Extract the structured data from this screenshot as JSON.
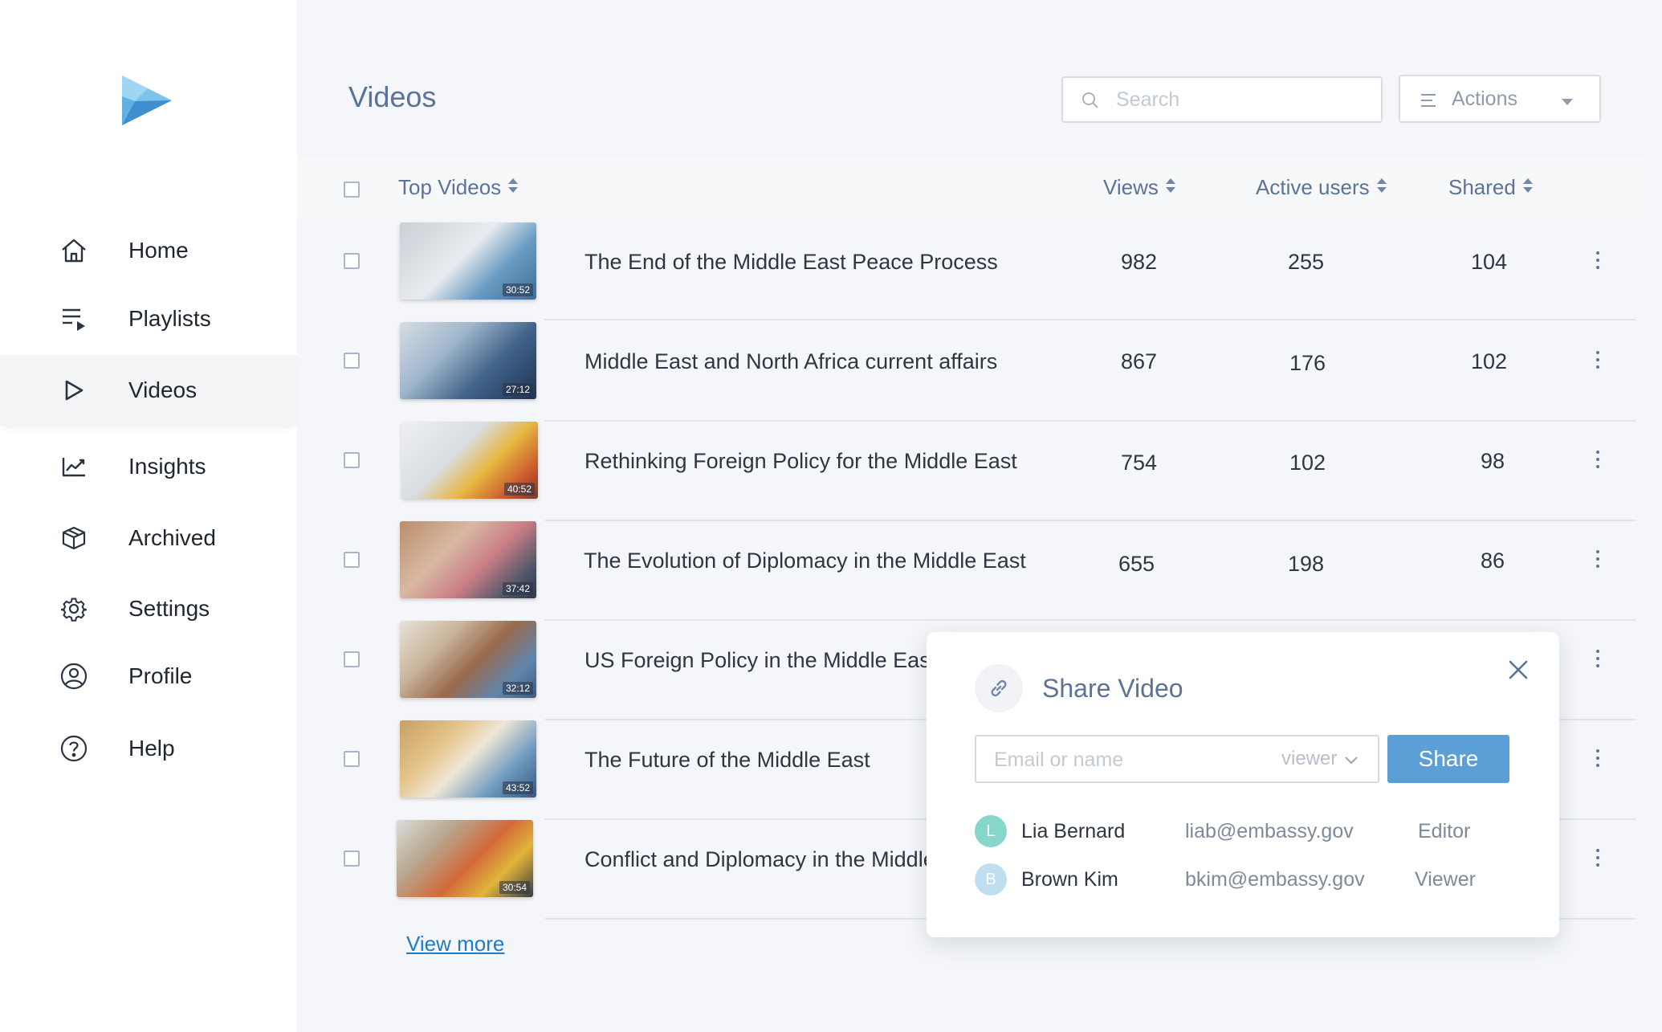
{
  "sidebar": {
    "logo_icon": "play-logo-icon",
    "items": [
      {
        "label": "Home",
        "icon": "home-icon"
      },
      {
        "label": "Playlists",
        "icon": "playlist-icon"
      },
      {
        "label": "Videos",
        "icon": "play-icon",
        "active": true
      },
      {
        "label": "Insights",
        "icon": "chart-icon"
      },
      {
        "label": "Archived",
        "icon": "box-icon"
      },
      {
        "label": "Settings",
        "icon": "gear-icon"
      },
      {
        "label": "Profile",
        "icon": "user-circle-icon"
      },
      {
        "label": "Help",
        "icon": "help-icon"
      }
    ]
  },
  "header": {
    "title": "Videos",
    "search_placeholder": "Search",
    "actions_label": "Actions"
  },
  "table": {
    "columns": {
      "title": "Top Videos",
      "views": "Views",
      "active_users": "Active users",
      "shared": "Shared"
    },
    "rows": [
      {
        "title": "The End of the Middle East Peace Process",
        "duration": "30:52",
        "views": "982",
        "active_users": "255",
        "shared": "104"
      },
      {
        "title": "Middle East and North Africa current affairs",
        "duration": "27:12",
        "views": "867",
        "active_users": "176",
        "shared": "102"
      },
      {
        "title": "Rethinking Foreign Policy for the Middle East",
        "duration": "40:52",
        "views": "754",
        "active_users": "102",
        "shared": "98"
      },
      {
        "title": "The Evolution of Diplomacy in the Middle East",
        "duration": "37:42",
        "views": "655",
        "active_users": "198",
        "shared": "86"
      },
      {
        "title": "US Foreign Policy in the Middle East",
        "duration": "32:12",
        "views": "",
        "active_users": "",
        "shared": ""
      },
      {
        "title": "The Future of the Middle East",
        "duration": "43:52",
        "views": "",
        "active_users": "",
        "shared": ""
      },
      {
        "title": "Conflict and Diplomacy in the Middle",
        "duration": "30:54",
        "views": "",
        "active_users": "",
        "shared": ""
      }
    ],
    "view_more": "View more"
  },
  "share_modal": {
    "title": "Share Video",
    "email_placeholder": "Email or name",
    "role_value": "viewer",
    "share_label": "Share",
    "people": [
      {
        "initial": "L",
        "name": "Lia Bernard",
        "email": "liab@embassy.gov",
        "role": "Editor",
        "color": "#86d6c9"
      },
      {
        "initial": "B",
        "name": "Brown Kim",
        "email": "bkim@embassy.gov",
        "role": "Viewer",
        "color": "#bfdff0"
      }
    ]
  },
  "colors": {
    "accent": "#5b9fd6",
    "title_blue": "#5a7396",
    "link": "#1f7cc4"
  }
}
